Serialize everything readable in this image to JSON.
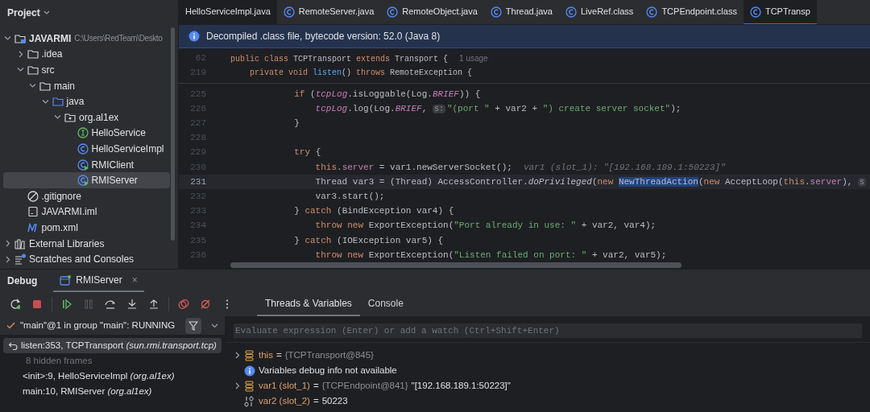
{
  "project_panel": {
    "title": "Project",
    "tree": [
      {
        "label": "JAVARMI",
        "path": "C:\\Users\\RedTeam\\Deskto",
        "kind": "project",
        "expanded": true,
        "selected": false,
        "children": [
          {
            "label": ".idea",
            "kind": "folder",
            "expanded": false,
            "selected": false
          },
          {
            "label": "src",
            "kind": "folder",
            "expanded": true,
            "selected": false,
            "children": [
              {
                "label": "main",
                "kind": "folder",
                "expanded": true,
                "selected": false,
                "children": [
                  {
                    "label": "java",
                    "kind": "source",
                    "expanded": true,
                    "selected": false,
                    "children": [
                      {
                        "label": "org.al1ex",
                        "kind": "package",
                        "expanded": true,
                        "selected": false,
                        "children": [
                          {
                            "label": "HelloService",
                            "kind": "interface",
                            "selected": false
                          },
                          {
                            "label": "HelloServiceImpl",
                            "kind": "class",
                            "selected": false
                          },
                          {
                            "label": "RMIClient",
                            "kind": "runnable",
                            "selected": false
                          },
                          {
                            "label": "RMIServer",
                            "kind": "runnable",
                            "selected": true
                          }
                        ]
                      }
                    ]
                  }
                ]
              }
            ]
          },
          {
            "label": ".gitignore",
            "kind": "ignore",
            "selected": false
          },
          {
            "label": "JAVARMI.iml",
            "kind": "iml",
            "selected": false
          },
          {
            "label": "pom.xml",
            "kind": "maven",
            "selected": false
          }
        ]
      },
      {
        "label": "External Libraries",
        "kind": "libraries",
        "expanded": false,
        "selected": false
      },
      {
        "label": "Scratches and Consoles",
        "kind": "scratches",
        "expanded": false,
        "selected": false
      }
    ]
  },
  "editor_tabs": [
    {
      "label": "HelloServiceImpl.java",
      "kind": "plain",
      "selected": false
    },
    {
      "label": "RemoteServer.java",
      "kind": "class",
      "selected": false
    },
    {
      "label": "RemoteObject.java",
      "kind": "class",
      "selected": false
    },
    {
      "label": "Thread.java",
      "kind": "class",
      "selected": false
    },
    {
      "label": "LiveRef.class",
      "kind": "class",
      "selected": false
    },
    {
      "label": "TCPEndpoint.class",
      "kind": "class",
      "selected": false
    },
    {
      "label": "TCPTransp",
      "kind": "class",
      "selected": true
    }
  ],
  "banner": "Decompiled .class file, bytecode version: 52.0 (Java 8)",
  "sticky_lines": [
    {
      "number": "62",
      "tokens": [
        {
          "kind": "kw",
          "text": "public class "
        },
        {
          "kind": "plain",
          "text": "TCPTransport "
        },
        {
          "kind": "kw",
          "text": "extends "
        },
        {
          "kind": "plain",
          "text": "Transport {"
        },
        {
          "kind": "hint",
          "text": "1 usage"
        }
      ]
    },
    {
      "number": "219",
      "tokens": [
        {
          "kind": "kw",
          "text": "    private void "
        },
        {
          "kind": "decl",
          "text": "listen"
        },
        {
          "kind": "plain",
          "text": "() "
        },
        {
          "kind": "kw",
          "text": "throws "
        },
        {
          "kind": "plain",
          "text": "RemoteException {"
        }
      ]
    }
  ],
  "code_lines": [
    {
      "number": "225",
      "current": false,
      "tokens": [
        {
          "kind": "kw",
          "text": "            if "
        },
        {
          "kind": "plain",
          "text": "("
        },
        {
          "kind": "static",
          "text": "tcpLog"
        },
        {
          "kind": "plain",
          "text": ".isLoggable(Log."
        },
        {
          "kind": "static",
          "text": "BRIEF"
        },
        {
          "kind": "plain",
          "text": ")) {"
        }
      ]
    },
    {
      "number": "226",
      "current": false,
      "tokens": [
        {
          "kind": "static",
          "text": "                tcpLog"
        },
        {
          "kind": "plain",
          "text": ".log(Log."
        },
        {
          "kind": "static",
          "text": "BRIEF"
        },
        {
          "kind": "plain",
          "text": ", "
        },
        {
          "kind": "param",
          "text": "s:"
        },
        {
          "kind": "str",
          "text": "\"(port \""
        },
        {
          "kind": "plain",
          "text": " + var2 + "
        },
        {
          "kind": "str",
          "text": "\") create server socket\""
        },
        {
          "kind": "plain",
          "text": ");"
        }
      ]
    },
    {
      "number": "227",
      "current": false,
      "tokens": [
        {
          "kind": "plain",
          "text": "            }"
        }
      ]
    },
    {
      "number": "228",
      "current": false
    },
    {
      "number": "229",
      "current": false,
      "tokens": [
        {
          "kind": "kw",
          "text": "            try "
        },
        {
          "kind": "plain",
          "text": "{"
        }
      ]
    },
    {
      "number": "230",
      "current": false,
      "tokens": [
        {
          "kind": "kw",
          "text": "                this"
        },
        {
          "kind": "plain",
          "text": "."
        },
        {
          "kind": "field",
          "text": "server"
        },
        {
          "kind": "plain",
          "text": " = var1.newServerSocket();"
        },
        {
          "kind": "inline",
          "text": "var1 (slot_1): \"[192.168.189.1:50223]\""
        }
      ]
    },
    {
      "number": "231",
      "current": true,
      "tokens": [
        {
          "kind": "plain",
          "text": "                Thread var3 = (Thread) AccessController."
        },
        {
          "kind": "staticm",
          "text": "doPrivileged"
        },
        {
          "kind": "plain",
          "text": "("
        },
        {
          "kind": "kw",
          "text": "new "
        },
        {
          "kind": "sel",
          "text": "NewThreadAction"
        },
        {
          "kind": "plain",
          "text": "("
        },
        {
          "kind": "kw",
          "text": "new "
        },
        {
          "kind": "plain",
          "text": "AcceptLoop("
        },
        {
          "kind": "kw",
          "text": "this"
        },
        {
          "kind": "plain",
          "text": "."
        },
        {
          "kind": "field",
          "text": "server"
        },
        {
          "kind": "plain",
          "text": "), "
        },
        {
          "kind": "param",
          "text": "s"
        }
      ]
    },
    {
      "number": "232",
      "current": false,
      "tokens": [
        {
          "kind": "plain",
          "text": "                var3.start();"
        }
      ]
    },
    {
      "number": "233",
      "current": false,
      "tokens": [
        {
          "kind": "plain",
          "text": "            } "
        },
        {
          "kind": "kw",
          "text": "catch "
        },
        {
          "kind": "plain",
          "text": "(BindException var4) {"
        }
      ]
    },
    {
      "number": "234",
      "current": false,
      "tokens": [
        {
          "kind": "kw",
          "text": "                throw new "
        },
        {
          "kind": "plain",
          "text": "ExportException("
        },
        {
          "kind": "str",
          "text": "\"Port already in use: \""
        },
        {
          "kind": "plain",
          "text": " + var2, var4);"
        }
      ]
    },
    {
      "number": "235",
      "current": false,
      "tokens": [
        {
          "kind": "plain",
          "text": "            } "
        },
        {
          "kind": "kw",
          "text": "catch "
        },
        {
          "kind": "plain",
          "text": "(IOException var5) {"
        }
      ]
    },
    {
      "number": "236",
      "current": false,
      "tokens": [
        {
          "kind": "kw",
          "text": "                throw new "
        },
        {
          "kind": "plain",
          "text": "ExportException("
        },
        {
          "kind": "str",
          "text": "\"Listen failed on port: \""
        },
        {
          "kind": "plain",
          "text": " + var2, var5);"
        }
      ]
    }
  ],
  "debug": {
    "title": "Debug",
    "session_tab": {
      "label": "RMIServer",
      "close": "×"
    },
    "toolbar": [
      {
        "kind": "rerun"
      },
      {
        "kind": "stop"
      },
      {
        "kind": "resume"
      },
      {
        "kind": "pause"
      },
      {
        "kind": "step-over"
      },
      {
        "kind": "step-into"
      },
      {
        "kind": "step-out"
      },
      {
        "kind": "view-breakpoints"
      },
      {
        "kind": "mute-breakpoints"
      },
      {
        "kind": "more"
      }
    ],
    "tabs": [
      {
        "label": "Threads & Variables",
        "selected": true
      },
      {
        "label": "Console",
        "selected": false
      }
    ],
    "thread": "\"main\"@1 in group \"main\": RUNNING",
    "frames": [
      {
        "kind": "frame",
        "text": "listen:353, TCPTransport *(sun.rmi.transport.tcp)*",
        "selected": true
      },
      {
        "kind": "hidden",
        "text": "8 hidden frames",
        "selected": false
      },
      {
        "kind": "frame",
        "text": "<init>:9, HelloServiceImpl *(org.al1ex)*",
        "selected": false
      },
      {
        "kind": "frame",
        "text": "main:10, RMIServer *(org.al1ex)*",
        "selected": false
      }
    ],
    "eval_placeholder": "Evaluate expression (Enter) or add a watch (Ctrl+Shift+Enter)",
    "variables": [
      {
        "kind": "object",
        "name": "this",
        "sep": "=",
        "ref": "{TCPTransport@845}",
        "expandable": true
      },
      {
        "kind": "info",
        "name": "Variables debug info not available",
        "expandable": false
      },
      {
        "kind": "object",
        "name": "var1 (slot_1)",
        "sep": "=",
        "ref": "{TCPEndpoint@841}",
        "value": "\"[192.168.189.1:50223]\"",
        "expandable": true
      },
      {
        "kind": "primitive",
        "name": "var2 (slot_2)",
        "sep": "=",
        "value": "50223",
        "expandable": false
      }
    ]
  }
}
